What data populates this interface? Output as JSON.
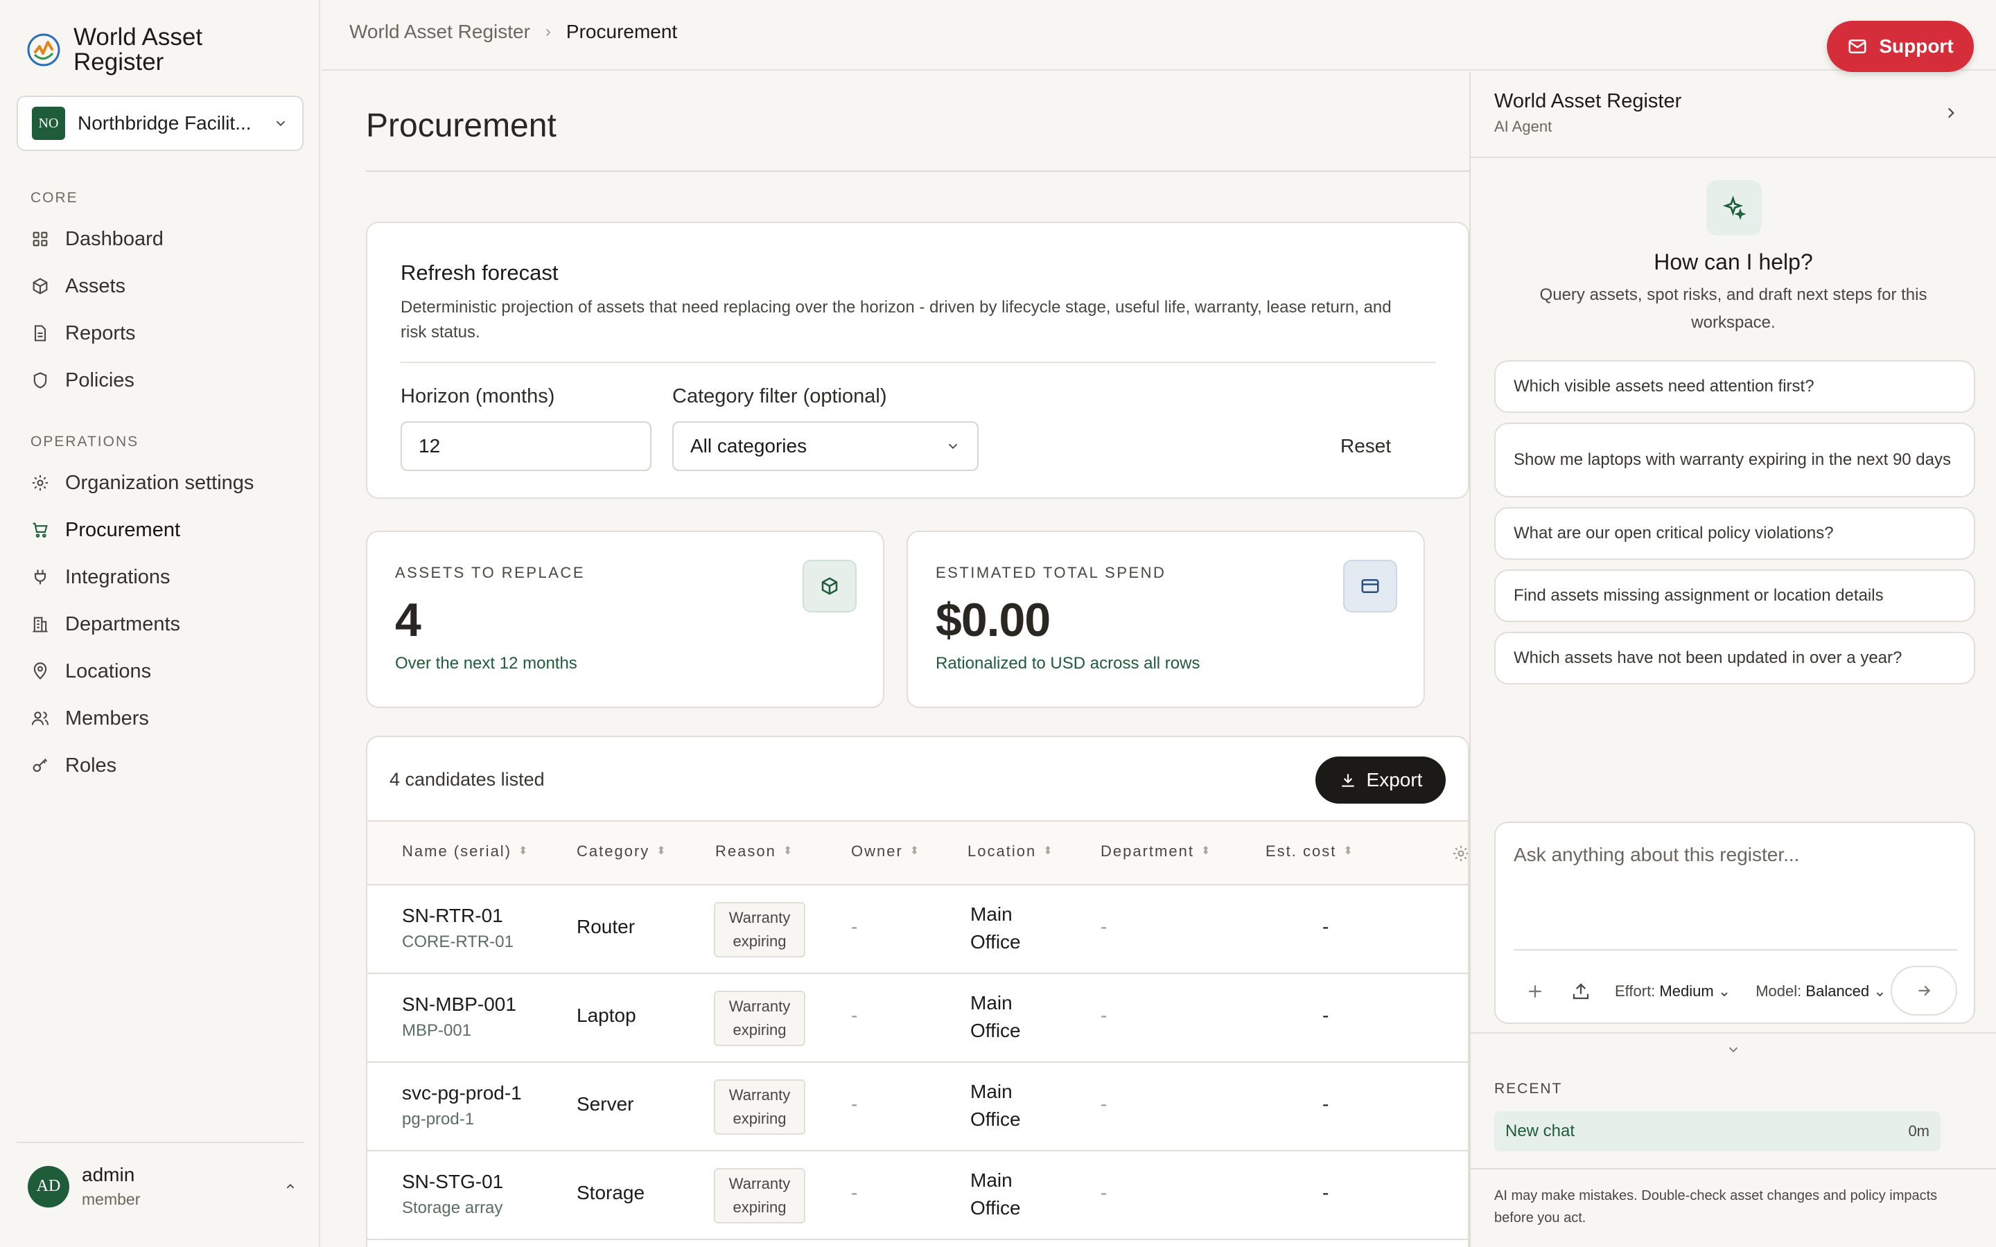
{
  "brand": {
    "name": "World Asset Register"
  },
  "org": {
    "initials": "NO",
    "name": "Northbridge Facilit..."
  },
  "sidebar": {
    "core_label": "CORE",
    "core_items": [
      {
        "label": "Dashboard",
        "icon": "grid-icon"
      },
      {
        "label": "Assets",
        "icon": "box-icon"
      },
      {
        "label": "Reports",
        "icon": "document-icon"
      },
      {
        "label": "Policies",
        "icon": "shield-icon"
      }
    ],
    "ops_label": "OPERATIONS",
    "ops_items": [
      {
        "label": "Organization settings",
        "icon": "gear-icon"
      },
      {
        "label": "Procurement",
        "icon": "cart-icon",
        "active": true
      },
      {
        "label": "Integrations",
        "icon": "plug-icon"
      },
      {
        "label": "Departments",
        "icon": "building-icon"
      },
      {
        "label": "Locations",
        "icon": "pin-icon"
      },
      {
        "label": "Members",
        "icon": "users-icon"
      },
      {
        "label": "Roles",
        "icon": "key-icon"
      }
    ]
  },
  "user": {
    "initials": "AD",
    "name": "admin",
    "role": "member"
  },
  "breadcrumb": {
    "root": "World Asset Register",
    "current": "Procurement"
  },
  "support": {
    "label": "Support"
  },
  "page": {
    "title": "Procurement"
  },
  "forecast": {
    "title": "Refresh forecast",
    "description": "Deterministic projection of assets that need replacing over the horizon - driven by lifecycle stage, useful life, warranty, lease return, and risk status.",
    "horizon_label": "Horizon (months)",
    "horizon_value": "12",
    "category_label": "Category filter (optional)",
    "category_value": "All categories",
    "reset_label": "Reset"
  },
  "stats": {
    "assets": {
      "label": "ASSETS TO REPLACE",
      "value": "4",
      "sub": "Over the next 12 months"
    },
    "spend": {
      "label": "ESTIMATED TOTAL SPEND",
      "value": "$0.00",
      "sub": "Rationalized to USD across all rows"
    }
  },
  "table": {
    "count_label": "4 candidates listed",
    "export_label": "Export",
    "headers": [
      "Name (serial)",
      "Category",
      "Reason",
      "Owner",
      "Location",
      "Department",
      "Est. cost"
    ],
    "rows": [
      {
        "serial": "SN-RTR-01",
        "name": "CORE-RTR-01",
        "category": "Router",
        "reason_l1": "Warranty",
        "reason_l2": "expiring",
        "owner": "-",
        "loc_l1": "Main",
        "loc_l2": "Office",
        "department": "-",
        "cost": "-"
      },
      {
        "serial": "SN-MBP-001",
        "name": "MBP-001",
        "category": "Laptop",
        "reason_l1": "Warranty",
        "reason_l2": "expiring",
        "owner": "-",
        "loc_l1": "Main",
        "loc_l2": "Office",
        "department": "-",
        "cost": "-"
      },
      {
        "serial": "svc-pg-prod-1",
        "name": "pg-prod-1",
        "category": "Server",
        "reason_l1": "Warranty",
        "reason_l2": "expiring",
        "owner": "-",
        "loc_l1": "Main",
        "loc_l2": "Office",
        "department": "-",
        "cost": "-"
      },
      {
        "serial": "SN-STG-01",
        "name": "Storage array",
        "category": "Storage",
        "reason_l1": "Warranty",
        "reason_l2": "expiring",
        "owner": "-",
        "loc_l1": "Main",
        "loc_l2": "Office",
        "department": "-",
        "cost": "-"
      }
    ]
  },
  "ai": {
    "title": "World Asset Register",
    "subtitle": "AI Agent",
    "help_title": "How can I help?",
    "help_sub": "Query assets, spot risks, and draft next steps for this workspace.",
    "suggestions": [
      "Which visible assets need attention first?",
      "Show me laptops with warranty expiring in the next 90 days",
      "What are our open critical policy violations?",
      "Find assets missing assignment or location details",
      "Which assets have not been updated in over a year?"
    ],
    "placeholder": "Ask anything about this register...",
    "effort_label": "Effort:",
    "effort_value": "Medium",
    "model_label": "Model:",
    "model_value": "Balanced",
    "recent_label": "RECENT",
    "recent_chat": "New chat",
    "recent_time": "0m",
    "disclaimer": "AI may make mistakes. Double-check asset changes and policy impacts before you act."
  },
  "colors": {
    "accent_green": "#1e5c3a",
    "support_red": "#d62d3a",
    "dark_button": "#1b1a17"
  }
}
